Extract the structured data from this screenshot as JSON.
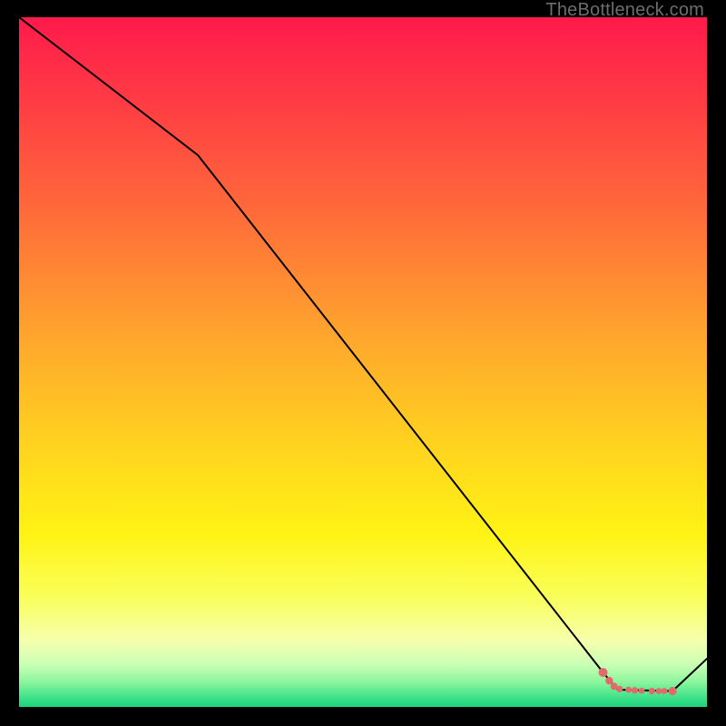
{
  "watermark": "TheBottleneck.com",
  "colors": {
    "line": "#000000",
    "marker_fill": "#e26a6a",
    "marker_stroke": "#c94d4d"
  },
  "chart_data": {
    "type": "line",
    "title": "",
    "xlabel": "",
    "ylabel": "",
    "xlim": [
      0,
      100
    ],
    "ylim": [
      0,
      100
    ],
    "gradient_stops": [
      {
        "offset": 0.0,
        "color": "#ff1a4b"
      },
      {
        "offset": 0.12,
        "color": "#ff3b44"
      },
      {
        "offset": 0.28,
        "color": "#ff6a3a"
      },
      {
        "offset": 0.45,
        "color": "#ffa22e"
      },
      {
        "offset": 0.62,
        "color": "#ffd31f"
      },
      {
        "offset": 0.75,
        "color": "#fff314"
      },
      {
        "offset": 0.84,
        "color": "#f9ff5a"
      },
      {
        "offset": 0.905,
        "color": "#f5ffae"
      },
      {
        "offset": 0.94,
        "color": "#c7ffb4"
      },
      {
        "offset": 0.965,
        "color": "#88f59c"
      },
      {
        "offset": 0.985,
        "color": "#42e38b"
      },
      {
        "offset": 1.0,
        "color": "#1ad47e"
      }
    ],
    "series": [
      {
        "name": "bottleneck-curve",
        "x": [
          0.0,
          26.0,
          84.9,
          87.0,
          95.0,
          100.0
        ],
        "y": [
          100.0,
          80.0,
          5.0,
          2.5,
          2.3,
          7.0
        ]
      }
    ],
    "markers": {
      "name": "highlight-points",
      "points": [
        {
          "x": 84.9,
          "y": 5.0,
          "r": 5.0
        },
        {
          "x": 85.8,
          "y": 3.8,
          "r": 4.2
        },
        {
          "x": 86.5,
          "y": 3.0,
          "r": 4.0
        },
        {
          "x": 87.3,
          "y": 2.6,
          "r": 3.6
        },
        {
          "x": 88.6,
          "y": 2.5,
          "r": 3.4
        },
        {
          "x": 89.5,
          "y": 2.4,
          "r": 3.6
        },
        {
          "x": 90.5,
          "y": 2.35,
          "r": 3.4
        },
        {
          "x": 92.0,
          "y": 2.3,
          "r": 3.6
        },
        {
          "x": 93.0,
          "y": 2.3,
          "r": 3.4
        },
        {
          "x": 93.8,
          "y": 2.3,
          "r": 3.4
        },
        {
          "x": 95.0,
          "y": 2.3,
          "r": 4.6
        }
      ]
    }
  }
}
